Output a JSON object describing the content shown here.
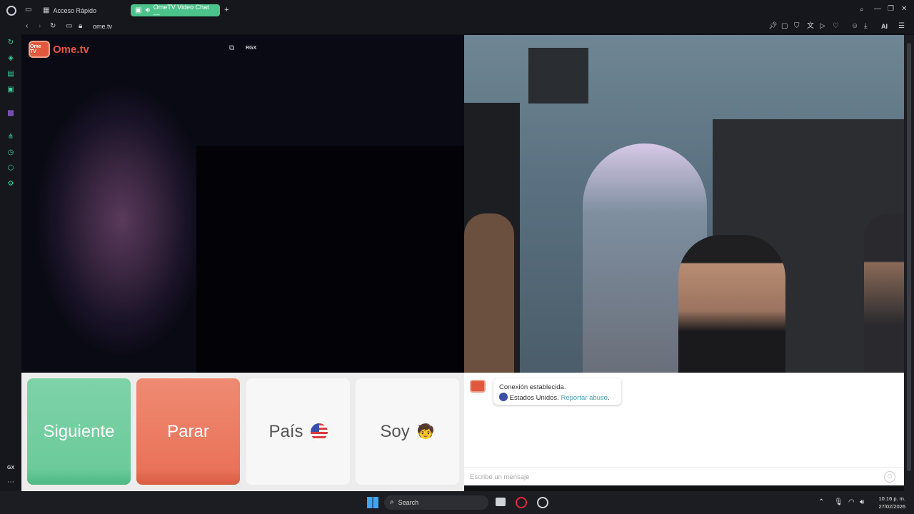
{
  "browser": {
    "tabs": [
      {
        "label": "Acceso Rápido"
      },
      {
        "label": "OmeTV Video Chat —"
      }
    ],
    "new_tab": "+",
    "url": "ome.tv",
    "ai_label": "AI",
    "gx_label": "GX"
  },
  "site": {
    "logo_badge": "Ome TV",
    "logo_text": "Ome.tv",
    "overlay_label": "RGX"
  },
  "controls": {
    "next_label": "Siguiente",
    "stop_label": "Parar",
    "country_label": "País",
    "gender_label": "Soy",
    "gender_emoji": "🧒"
  },
  "chat": {
    "connection_text": "Conexión establecida.",
    "country_text": "Estados Unidos.",
    "report_link": "Reportar abuso",
    "report_period": ".",
    "input_placeholder": "Escribe un mensaje"
  },
  "taskbar": {
    "search_label": "Search",
    "time": "10:16 p. m.",
    "date": "27/02/2026"
  },
  "colors": {
    "accent_green": "#4cc38a",
    "next_green": "#6ccb9a",
    "stop_red": "#e9735a",
    "brand_orange": "#e2583e"
  }
}
